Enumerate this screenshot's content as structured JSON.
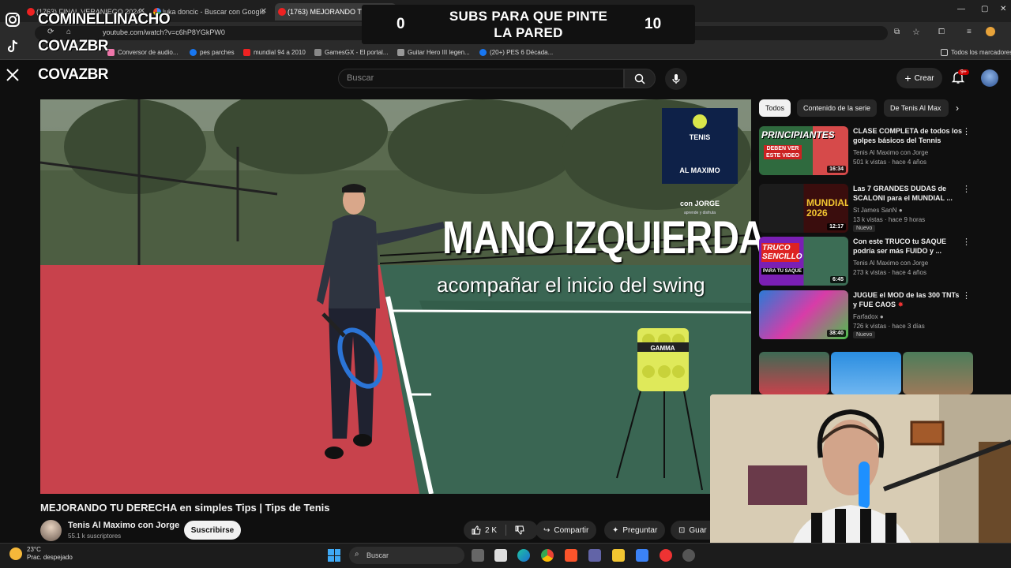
{
  "browser": {
    "tabs": [
      {
        "label": "(1763) FINAL VERANIEGO 2024..."
      },
      {
        "label": "luka doncic - Buscar con Google"
      },
      {
        "label": "(1763) MEJORANDO TU DE..."
      }
    ],
    "new_tab": "+",
    "url": "youtube.com/watch?v=c6hP8YGkPW0",
    "bookmarks": [
      {
        "label": "Conversor de audio..."
      },
      {
        "label": "pes parches"
      },
      {
        "label": "mundial 94 a 2010"
      },
      {
        "label": "GamesGX - El portal..."
      },
      {
        "label": "Guitar Hero III legen..."
      },
      {
        "label": "(20+) PES 6 Década..."
      }
    ],
    "all_bookmarks": "Todos los marcadores"
  },
  "overlay": {
    "banner_title": "SUBS PARA QUE PINTE\nLA PARED",
    "left_count": "0",
    "right_count": "10",
    "socials": [
      {
        "icon": "instagram-icon",
        "name": "COMINELLINACHO"
      },
      {
        "icon": "tiktok-icon",
        "name": "COVAZBR"
      },
      {
        "icon": "x-icon",
        "name": "COVAZBR"
      }
    ]
  },
  "youtube": {
    "search_placeholder": "Buscar",
    "create_label": "Crear",
    "notif_badge": "9+"
  },
  "video": {
    "overlay_title": "MANO IZQUIERDA",
    "overlay_subtitle": "acompañar el inicio del swing",
    "logo_line1": "TENIS",
    "logo_line2": "AL MAXIMO",
    "logo_line3": "con JORGE",
    "logo_tagline": "aprende y disfruta",
    "ball_brand": "GAMMA",
    "title": "MEJORANDO TU DERECHA en simples Tips | Tips de Tenis",
    "channel": "Tenis Al Maximo con Jorge",
    "subscribers": "55.1 k suscriptores",
    "subscribe_label": "Suscribirse",
    "likes": "2 K",
    "share_label": "Compartir",
    "ask_label": "Preguntar",
    "save_label": "Guar"
  },
  "chips": [
    {
      "label": "Todos",
      "active": true
    },
    {
      "label": "Contenido de la serie",
      "active": false
    },
    {
      "label": "De Tenis Al Max",
      "active": false
    }
  ],
  "recommendations": [
    {
      "title": "CLASE COMPLETA de todos los golpes básicos del Tennis",
      "channel": "Tenis Al Maximo con Jorge",
      "meta": "501 k vistas · hace 4 años",
      "duration": "16:34",
      "badge": "",
      "thumb_text": "PRINCIPIANTES",
      "thumb_text2": "DEBEN VER ESTE VIDEO",
      "verified": false
    },
    {
      "title": "Las 7 GRANDES DUDAS de SCALONI para el MUNDIAL ...",
      "channel": "St James SanN",
      "meta": "13 k vistas · hace 9 horas",
      "duration": "12:17",
      "badge": "Nuevo",
      "thumb_text": "MUNDIAL 2026",
      "thumb_text2": "",
      "verified": true
    },
    {
      "title": "Con este TRUCO tu SAQUE podría ser más FUIDO y ...",
      "channel": "Tenis Al Maximo con Jorge",
      "meta": "273 k vistas · hace 4 años",
      "duration": "6:45",
      "badge": "",
      "thumb_text": "TRUCO SENCILLO",
      "thumb_text2": "PARA TU SAQUE",
      "verified": false
    },
    {
      "title": "JUGUE el MOD de las 300 TNTs y FUE CAOS",
      "channel": "Farfadox",
      "meta": "726 k vistas · hace 3 días",
      "duration": "38:40",
      "badge": "Nuevo",
      "thumb_text": "",
      "thumb_text2": "",
      "verified": true
    }
  ],
  "taskbar": {
    "temperature": "23°C",
    "weather": "Prac. despejado",
    "search_label": "Buscar"
  }
}
